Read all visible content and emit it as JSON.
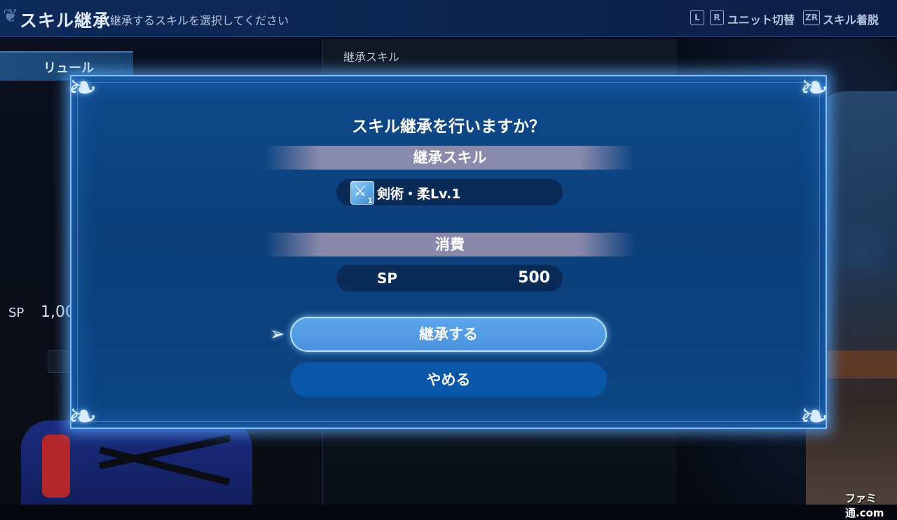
{
  "header": {
    "title": "スキル継承",
    "subtitle": "継承するスキルを選択してください",
    "key_l": "L",
    "key_r": "R",
    "unit_switch_label": "ユニット切替",
    "key_zr": "ZR",
    "skill_equip_label": "スキル着脱"
  },
  "background": {
    "character_name": "リュール",
    "sp_label": "SP",
    "sp_value": "1,00",
    "mid_panel_label": "継承スキル"
  },
  "dialog": {
    "title": "スキル継承を行いますか？",
    "skill_section_label": "継承スキル",
    "skill": {
      "icon": "sword-icon",
      "icon_level": "1",
      "name": "剣術・柔Lv.1"
    },
    "cost_section_label": "消費",
    "cost": {
      "label": "SP",
      "value": "500"
    },
    "confirm_button": "継承する",
    "cancel_button": "やめる"
  },
  "watermark": "ファミ通.com",
  "colors": {
    "dialog_bg": "#0d4584",
    "dialog_border": "#7fc0ff",
    "selected_button": "#5ea6ea",
    "unselected_button": "#0a56a8"
  }
}
